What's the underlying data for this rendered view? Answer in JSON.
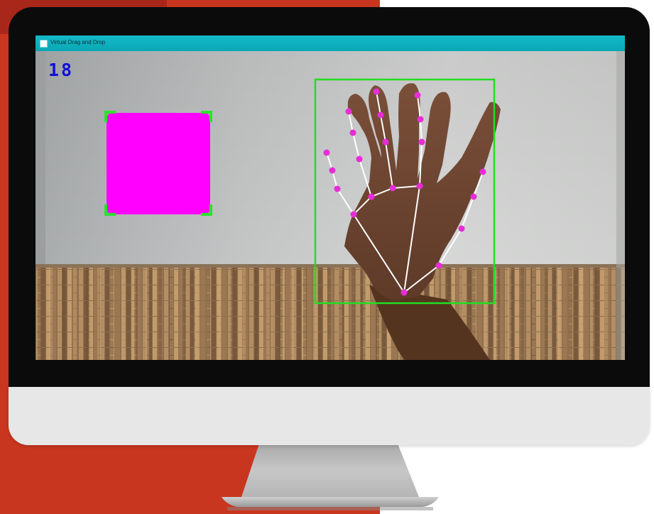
{
  "window": {
    "title": "Virtual Drag and Drop"
  },
  "overlay": {
    "fps": "18"
  },
  "drag_box": {
    "color": "#ff00ff",
    "corner_color": "#2ee02e"
  },
  "hand_box": {
    "color": "#22dd22"
  },
  "landmarks": {
    "point_color": "#e82cd8",
    "line_color": "#ffffff"
  },
  "colors": {
    "title_bar": "#0fb2c1",
    "accent_bg": "#c8361f"
  }
}
